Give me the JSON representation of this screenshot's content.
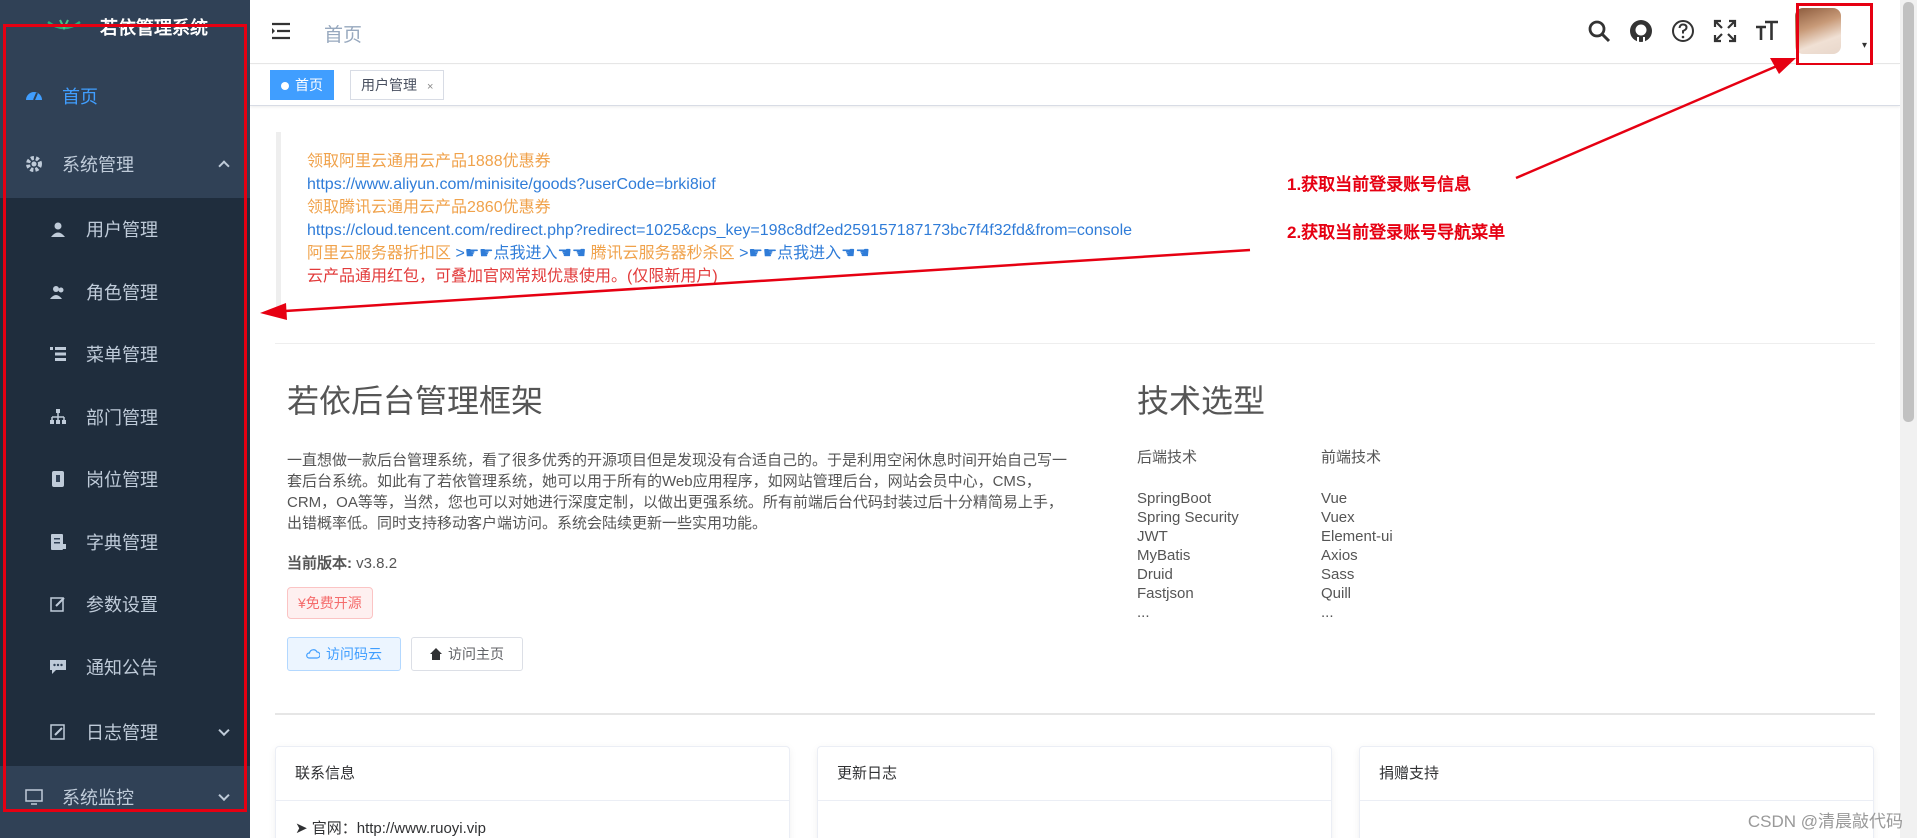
{
  "brand": {
    "title": "若依管理系统",
    "logo_icon": "leaf-logo"
  },
  "sidebar": {
    "home": {
      "label": "首页",
      "icon": "dashboard-icon"
    },
    "system": {
      "label": "系统管理",
      "icon": "gear-icon"
    },
    "sub_items": [
      {
        "label": "用户管理",
        "icon": "user-icon"
      },
      {
        "label": "角色管理",
        "icon": "peoples-icon"
      },
      {
        "label": "菜单管理",
        "icon": "tree-table-icon"
      },
      {
        "label": "部门管理",
        "icon": "tree-icon"
      },
      {
        "label": "岗位管理",
        "icon": "post-icon"
      },
      {
        "label": "字典管理",
        "icon": "dict-icon"
      },
      {
        "label": "参数设置",
        "icon": "edit-icon"
      },
      {
        "label": "通知公告",
        "icon": "message-icon"
      }
    ],
    "log": {
      "label": "日志管理",
      "icon": "log-icon"
    },
    "monitor": {
      "label": "系统监控",
      "icon": "monitor-icon"
    }
  },
  "navbar": {
    "breadcrumb": "首页",
    "icons": [
      "search-icon",
      "github-icon",
      "question-icon",
      "fullscreen-icon",
      "font-size-icon"
    ]
  },
  "tags": {
    "home": "首页",
    "user": "用户管理",
    "close": "×"
  },
  "notice": {
    "line1": "领取阿里云通用云产品1888优惠券",
    "line2": "https://www.aliyun.com/minisite/goods?userCode=brki8iof",
    "line3": "领取腾讯云通用云产品2860优惠券",
    "line4": "https://cloud.tencent.com/redirect.php?redirect=1025&cps_key=198c8df2ed259157187173bc7f4f32fd&from=console",
    "line5a": "阿里云服务器折扣区",
    "line5b": ">☛☛点我进入☚☚",
    "line5c": "腾讯云服务器秒杀区",
    "line5d": ">☛☛点我进入☚☚",
    "line6": "云产品通用红包，可叠加官网常规优惠使用。(仅限新用户)"
  },
  "intro": {
    "title": "若依后台管理框架",
    "desc": "一直想做一款后台管理系统，看了很多优秀的开源项目但是发现没有合适自己的。于是利用空闲休息时间开始自己写一套后台系统。如此有了若依管理系统，她可以用于所有的Web应用程序，如网站管理后台，网站会员中心，CMS，CRM，OA等等，当然，您也可以对她进行深度定制，以做出更强系统。所有前端后台代码封装过后十分精简易上手，出错概率低。同时支持移动客户端访问。系统会陆续更新一些实用功能。",
    "version_label": "当前版本:",
    "version": "v3.8.2",
    "badge": "¥免费开源",
    "btn_gitee": "访问码云",
    "btn_home": "访问主页"
  },
  "tech": {
    "title": "技术选型",
    "backend_head": "后端技术",
    "frontend_head": "前端技术",
    "backend": [
      "SpringBoot",
      "Spring Security",
      "JWT",
      "MyBatis",
      "Druid",
      "Fastjson",
      "..."
    ],
    "frontend": [
      "Vue",
      "Vuex",
      "Element-ui",
      "Axios",
      "Sass",
      "Quill",
      "..."
    ]
  },
  "cards": [
    {
      "title": "联系信息",
      "body": "官网：http://www.ruoyi.vip"
    },
    {
      "title": "更新日志",
      "body": ""
    },
    {
      "title": "捐赠支持",
      "body": ""
    }
  ],
  "annotations": {
    "a1": "1.获取当前登录账号信息",
    "a2": "2.获取当前登录账号导航菜单"
  },
  "watermark": "CSDN @清晨敲代码",
  "colors": {
    "sidebar_bg": "#304156",
    "active": "#409eff",
    "annotation": "#e60012"
  }
}
